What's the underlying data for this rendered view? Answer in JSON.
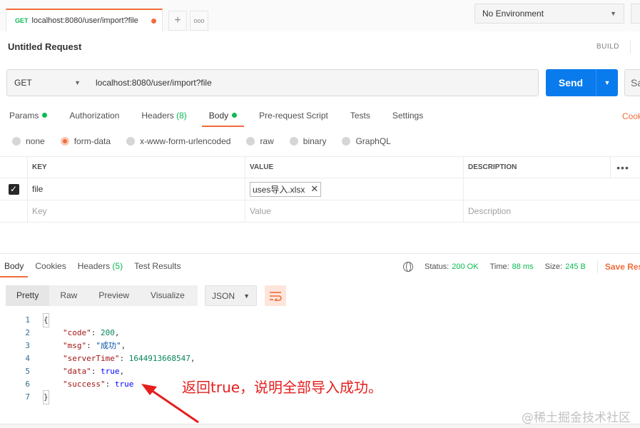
{
  "tab": {
    "method": "GET",
    "url": "localhost:8080/user/import?file"
  },
  "tab_controls": {
    "add": "+",
    "more": "ooo"
  },
  "environment": {
    "label": "No Environment"
  },
  "request": {
    "title": "Untitled Request",
    "build": "BUILD",
    "method": "GET",
    "url": "localhost:8080/user/import?file",
    "send": "Send",
    "save": "Sa"
  },
  "request_tabs": [
    {
      "label": "Params",
      "dot": true
    },
    {
      "label": "Authorization"
    },
    {
      "label": "Headers",
      "count": "(8)"
    },
    {
      "label": "Body",
      "dot": true,
      "active": true
    },
    {
      "label": "Pre-request Script"
    },
    {
      "label": "Tests"
    },
    {
      "label": "Settings"
    }
  ],
  "cookies_link": "Cook",
  "body_types": [
    {
      "label": "none"
    },
    {
      "label": "form-data",
      "selected": true
    },
    {
      "label": "x-www-form-urlencoded"
    },
    {
      "label": "raw"
    },
    {
      "label": "binary"
    },
    {
      "label": "GraphQL"
    }
  ],
  "table": {
    "headers": {
      "key": "KEY",
      "value": "VALUE",
      "description": "DESCRIPTION"
    },
    "more": "•••",
    "row": {
      "key": "file",
      "value": "uses导入.xlsx",
      "remove": "✕"
    },
    "placeholders": {
      "key": "Key",
      "value": "Value",
      "description": "Description"
    }
  },
  "response": {
    "tabs": [
      {
        "label": "Body",
        "active": true
      },
      {
        "label": "Cookies"
      },
      {
        "label": "Headers",
        "count": "(5)"
      },
      {
        "label": "Test Results"
      }
    ],
    "status_label": "Status:",
    "status_value": "200 OK",
    "time_label": "Time:",
    "time_value": "88 ms",
    "size_label": "Size:",
    "size_value": "245 B",
    "save": "Save Res",
    "formats": [
      "Pretty",
      "Raw",
      "Preview",
      "Visualize"
    ],
    "language": "JSON"
  },
  "code": {
    "line_numbers": [
      "1",
      "2",
      "3",
      "4",
      "5",
      "6",
      "7"
    ],
    "open": "{",
    "close": "}",
    "entries": [
      {
        "key": "\"code\"",
        "value": "200",
        "type": "number",
        "comma": ","
      },
      {
        "key": "\"msg\"",
        "value": "\"成功\"",
        "type": "string",
        "comma": ","
      },
      {
        "key": "\"serverTime\"",
        "value": "1644913668547",
        "type": "number",
        "comma": ","
      },
      {
        "key": "\"data\"",
        "value": "true",
        "type": "bool",
        "comma": ","
      },
      {
        "key": "\"success\"",
        "value": "true",
        "type": "bool",
        "comma": ""
      }
    ]
  },
  "annotation": "返回true，说明全部导入成功。",
  "watermark": "@稀土掘金技术社区",
  "colors": {
    "accent": "#f26b3a",
    "send": "#097bed",
    "green": "#0cbb52",
    "annotation": "#e61e1e"
  }
}
